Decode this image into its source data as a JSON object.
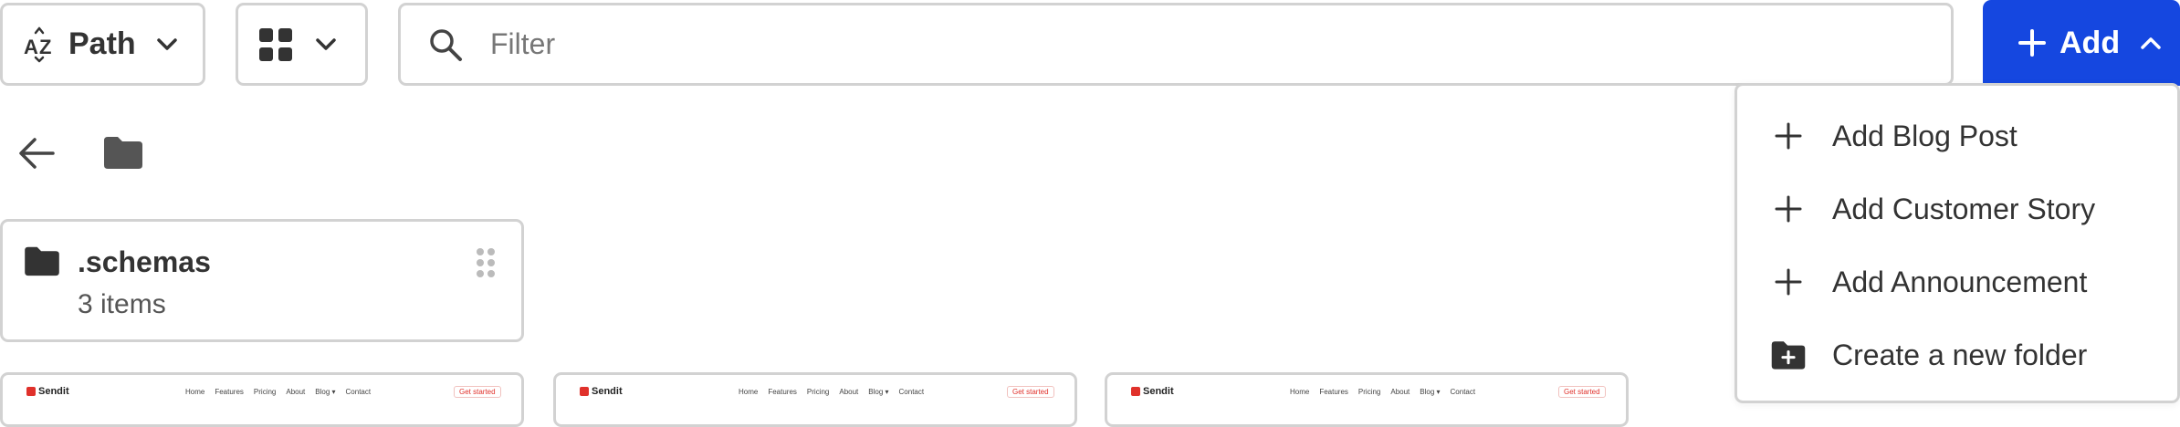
{
  "toolbar": {
    "sort_label": "Path",
    "filter_placeholder": "Filter",
    "add_label": "Add"
  },
  "folder_card": {
    "name": ".schemas",
    "count": "3 items"
  },
  "previews": [
    {
      "brand": "Sendit",
      "nav": [
        "Home",
        "Features",
        "Pricing",
        "About",
        "Blog ▾",
        "Contact"
      ],
      "cta": "Get started"
    },
    {
      "brand": "Sendit",
      "nav": [
        "Home",
        "Features",
        "Pricing",
        "About",
        "Blog ▾",
        "Contact"
      ],
      "cta": "Get started"
    },
    {
      "brand": "Sendit",
      "nav": [
        "Home",
        "Features",
        "Pricing",
        "About",
        "Blog ▾",
        "Contact"
      ],
      "cta": "Get started"
    }
  ],
  "add_menu": {
    "items": [
      {
        "label": "Add Blog Post",
        "icon": "plus-icon"
      },
      {
        "label": "Add Customer Story",
        "icon": "plus-icon"
      },
      {
        "label": "Add Announcement",
        "icon": "plus-icon"
      },
      {
        "label": "Create a new folder",
        "icon": "folder-plus-icon"
      }
    ]
  },
  "colors": {
    "accent": "#1547e0",
    "border": "#d2d2d2",
    "text": "#333333"
  }
}
